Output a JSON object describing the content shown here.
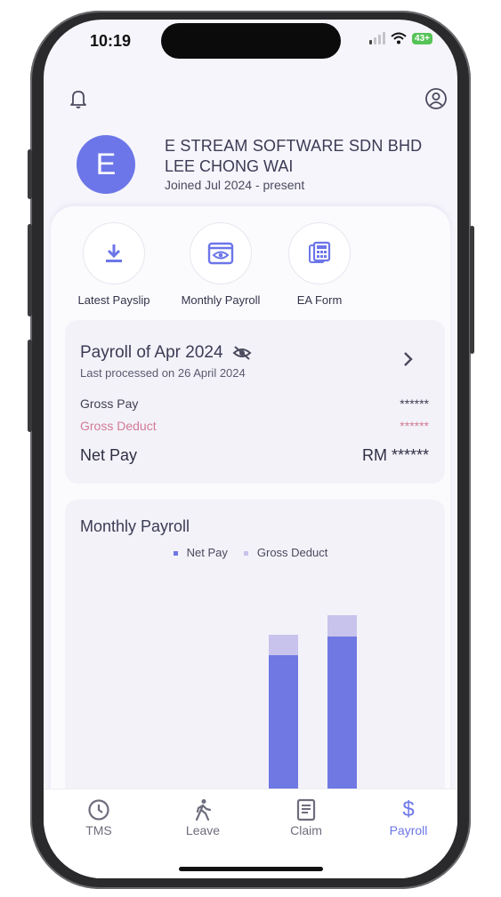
{
  "status_bar": {
    "time": "10:19",
    "battery": "43+"
  },
  "header": {
    "avatar_initial": "E",
    "company": "E STREAM SOFTWARE SDN BHD",
    "employee": "LEE CHONG WAI",
    "joined": "Joined Jul 2024 - present"
  },
  "quick_actions": [
    {
      "label": "Latest Payslip",
      "icon": "download-icon"
    },
    {
      "label": "Monthly Payroll",
      "icon": "eye-icon"
    },
    {
      "label": "EA Form",
      "icon": "calculator-icon"
    }
  ],
  "payroll_card": {
    "title": "Payroll of Apr 2024",
    "subtitle": "Last processed on 26 April 2024",
    "gross_pay_label": "Gross Pay",
    "gross_pay_value": "******",
    "gross_deduct_label": "Gross Deduct",
    "gross_deduct_value": "******",
    "net_pay_label": "Net Pay",
    "net_pay_value": "RM ******"
  },
  "monthly_payroll": {
    "title": "Monthly Payroll",
    "legend": [
      "Net Pay",
      "Gross Deduct"
    ]
  },
  "colors": {
    "accent": "#6c76e8",
    "net_pay": "#6f78e3",
    "gross_deduct": "#c8c3ec",
    "deduct_text": "#d27b93"
  },
  "tabs": [
    {
      "label": "TMS",
      "icon": "clock-icon"
    },
    {
      "label": "Leave",
      "icon": "walk-icon"
    },
    {
      "label": "Claim",
      "icon": "receipt-icon"
    },
    {
      "label": "Payroll",
      "icon": "dollar-icon",
      "active": true
    }
  ]
}
